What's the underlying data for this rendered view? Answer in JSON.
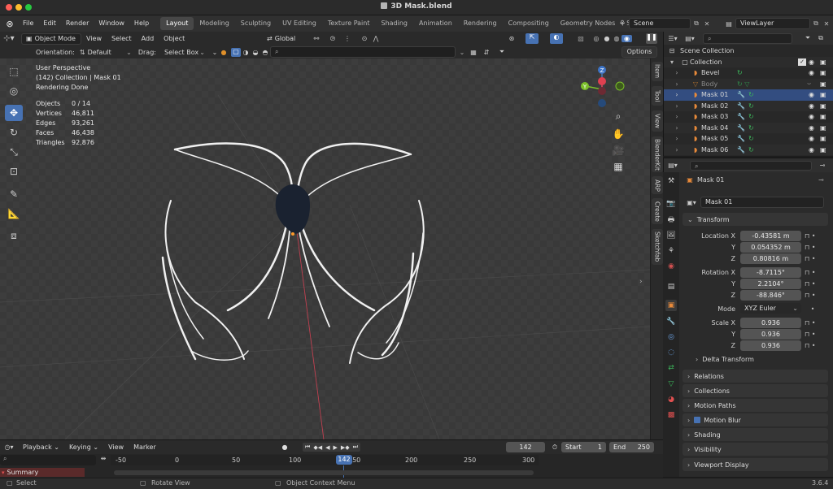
{
  "window": {
    "title": "3D Mask.blend"
  },
  "menu": [
    "File",
    "Edit",
    "Render",
    "Window",
    "Help"
  ],
  "workspaces": [
    "Layout",
    "Modeling",
    "Sculpting",
    "UV Editing",
    "Texture Paint",
    "Shading",
    "Animation",
    "Rendering",
    "Compositing",
    "Geometry Nodes",
    "Scripting"
  ],
  "active_workspace": "Layout",
  "scene": {
    "label": "Scene",
    "view_layer": "ViewLayer"
  },
  "viewport_header": {
    "mode": "Object Mode",
    "menus": [
      "View",
      "Select",
      "Add",
      "Object"
    ],
    "transform": "Global",
    "orientation_label": "Orientation:",
    "orientation": "Default",
    "drag_label": "Drag:",
    "drag": "Select Box",
    "options": "Options"
  },
  "overlay": {
    "view": "User Perspective",
    "collection": "(142) Collection | Mask 01",
    "status": "Rendering Done"
  },
  "stats": [
    {
      "label": "Objects",
      "value": "0 / 14"
    },
    {
      "label": "Vertices",
      "value": "46,811"
    },
    {
      "label": "Edges",
      "value": "93,261"
    },
    {
      "label": "Faces",
      "value": "46,438"
    },
    {
      "label": "Triangles",
      "value": "92,876"
    }
  ],
  "side_tabs": [
    "Item",
    "Tool",
    "View",
    "BlenderKit",
    "ARP",
    "Create",
    "Sketchfab"
  ],
  "gizmo": {
    "z": "Z",
    "y": "Y"
  },
  "outliner": {
    "root": "Scene Collection",
    "collection": "Collection",
    "items": [
      "Bevel",
      "Body",
      "Mask 01",
      "Mask 02",
      "Mask 03",
      "Mask 04",
      "Mask 05",
      "Mask 06"
    ]
  },
  "properties": {
    "object_name": "Mask 01",
    "datablock": "Mask 01",
    "transform_header": "Transform",
    "location": {
      "label": "Location X",
      "x": "-0.43581 m",
      "y": "0.054352 m",
      "z": "0.80816 m"
    },
    "rotation": {
      "label": "Rotation X",
      "x": "-8.7115°",
      "y": "2.2104°",
      "z": "-88.846°"
    },
    "mode": {
      "label": "Mode",
      "value": "XYZ Euler"
    },
    "scale": {
      "label": "Scale X",
      "x": "0.936",
      "y": "0.936",
      "z": "0.936"
    },
    "axis": {
      "y": "Y",
      "z": "Z"
    },
    "delta": "Delta Transform",
    "panels": [
      "Relations",
      "Collections",
      "Motion Paths",
      "Motion Blur",
      "Shading",
      "Visibility",
      "Viewport Display"
    ]
  },
  "timeline": {
    "menus": [
      "Playback",
      "Keying",
      "View",
      "Marker"
    ],
    "current_frame": "142",
    "start_label": "Start",
    "start": "1",
    "end_label": "End",
    "end": "250",
    "ruler": [
      "-50",
      "0",
      "50",
      "100",
      "150",
      "200",
      "250",
      "300"
    ],
    "summary": "Summary"
  },
  "status": {
    "select": "Select",
    "rotate": "Rotate View",
    "context": "Object Context Menu",
    "version": "3.6.4"
  },
  "colors": {
    "accent": "#4772b3",
    "selected_row": "#334d80",
    "orange": "#e88a3a"
  }
}
